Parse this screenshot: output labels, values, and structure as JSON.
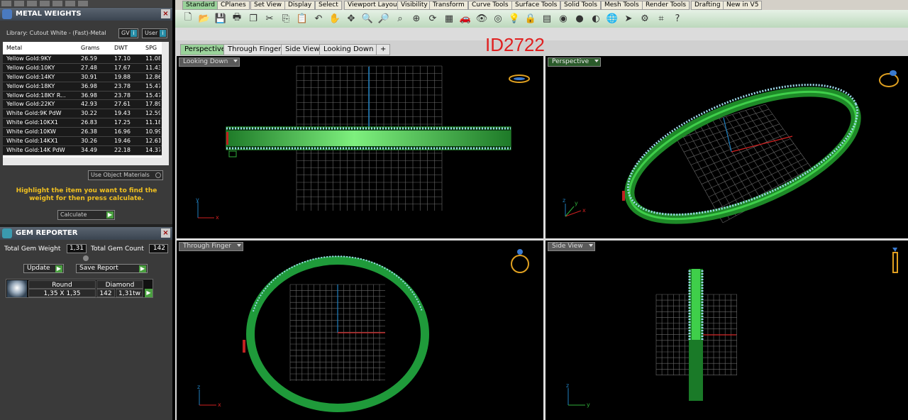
{
  "metal_weights": {
    "title": "METAL WEIGHTS",
    "library": "Library: Cutout White - (Fast)-Metal",
    "gv": "GV",
    "user": "User",
    "columns": [
      "Metal",
      "Grams",
      "DWT",
      "SPG"
    ],
    "rows": [
      [
        "Yellow Gold:9KY",
        "26.59",
        "17.10",
        "11.08"
      ],
      [
        "Yellow Gold:10KY",
        "27.48",
        "17.67",
        "11.43"
      ],
      [
        "Yellow Gold:14KY",
        "30.91",
        "19.88",
        "12.86"
      ],
      [
        "Yellow Gold:18KY",
        "36.98",
        "23.78",
        "15.47"
      ],
      [
        "Yellow Gold:18KY R...",
        "36.98",
        "23.78",
        "15.47"
      ],
      [
        "Yellow Gold:22KY",
        "42.93",
        "27.61",
        "17.89"
      ],
      [
        "White Gold:9K PdW",
        "30.22",
        "19.43",
        "12.59"
      ],
      [
        "White Gold:10KX1",
        "26.83",
        "17.25",
        "11.18"
      ],
      [
        "White Gold:10KW",
        "26.38",
        "16.96",
        "10.99"
      ],
      [
        "White Gold:14KX1",
        "30.26",
        "19.46",
        "12.61"
      ],
      [
        "White Gold:14K PdW",
        "34.49",
        "22.18",
        "14.37"
      ]
    ],
    "use_object_materials": "Use Object Materials",
    "hint": "Highlight the item you want to find the weight for then press calculate.",
    "calculate": "Calculate"
  },
  "gem_reporter": {
    "title": "GEM REPORTER",
    "total_weight_label": "Total Gem Weight",
    "total_weight_value": "1,31",
    "total_count_label": "Total Gem Count",
    "total_count_value": "142",
    "update": "Update",
    "save_report": "Save Report",
    "gem": {
      "shape": "Round",
      "size": "1,35 X 1,35",
      "type": "Diamond",
      "count": "142",
      "weight": "1,31tw"
    }
  },
  "toolbar_tabs": [
    "Standard",
    "CPlanes",
    "Set View",
    "Display",
    "Select",
    "Viewport Layout",
    "Visibility",
    "Transform",
    "Curve Tools",
    "Surface Tools",
    "Solid Tools",
    "Mesh Tools",
    "Render Tools",
    "Drafting",
    "New in V5"
  ],
  "viewport_tabs": [
    "Perspective",
    "Through Finger",
    "Side View",
    "Looking Down",
    "+"
  ],
  "id_label": "ID2722",
  "viewports": {
    "top_left": {
      "label": "Looking Down",
      "axis1": "y",
      "axis2": "x"
    },
    "top_right": {
      "label": "Perspective",
      "axis1": "z",
      "axis2": "x",
      "axis3": "y"
    },
    "bottom_left": {
      "label": "Through Finger",
      "axis1": "z",
      "axis2": "x"
    },
    "bottom_right": {
      "label": "Side View",
      "axis1": "z",
      "axis2": "y"
    }
  },
  "colors": {
    "metal": "#2fae3a",
    "gems": "#9ad8e8",
    "grid": "#888888",
    "red_axis": "#d02020",
    "blue_axis": "#2080c0",
    "accent_tab": "#9ad29a",
    "id_red": "#e02020"
  }
}
